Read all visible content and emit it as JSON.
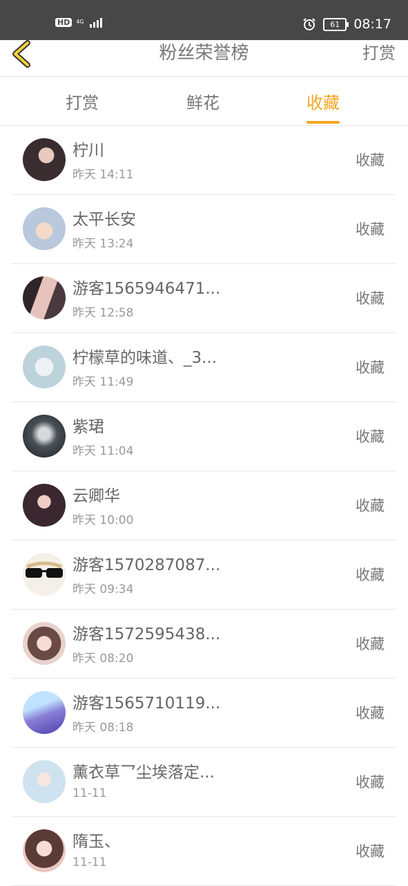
{
  "status_bar": {
    "hd_label": "HD",
    "network_label": "4G",
    "time": "08:17",
    "battery": "61"
  },
  "header": {
    "title": "粉丝荣誉榜",
    "right_action": "打赏"
  },
  "tabs": [
    {
      "label": "打赏",
      "active": false
    },
    {
      "label": "鲜花",
      "active": false
    },
    {
      "label": "收藏",
      "active": true
    }
  ],
  "rows": [
    {
      "name": "柠川",
      "time": "昨天 14:11",
      "action": "收藏"
    },
    {
      "name": "太平长安",
      "time": "昨天 13:24",
      "action": "收藏"
    },
    {
      "name": "游客1565946471...",
      "time": "昨天 12:58",
      "action": "收藏"
    },
    {
      "name": "柠檬草的味道、_3...",
      "time": "昨天 11:49",
      "action": "收藏"
    },
    {
      "name": "紫珺",
      "time": "昨天 11:04",
      "action": "收藏"
    },
    {
      "name": "云卿华",
      "time": "昨天 10:00",
      "action": "收藏"
    },
    {
      "name": "游客1570287087...",
      "time": "昨天 09:34",
      "action": "收藏"
    },
    {
      "name": "游客1572595438...",
      "time": "昨天 08:20",
      "action": "收藏"
    },
    {
      "name": "游客1565710119...",
      "time": "昨天 08:18",
      "action": "收藏"
    },
    {
      "name": "薰衣草乛尘埃落定...",
      "time": "11-11",
      "action": "收藏"
    },
    {
      "name": "隋玉、",
      "time": "11-11",
      "action": "收藏"
    }
  ],
  "colors": {
    "accent": "#f3a623",
    "status_bar_bg": "#474747",
    "back_arrow": "#f2d23a"
  }
}
